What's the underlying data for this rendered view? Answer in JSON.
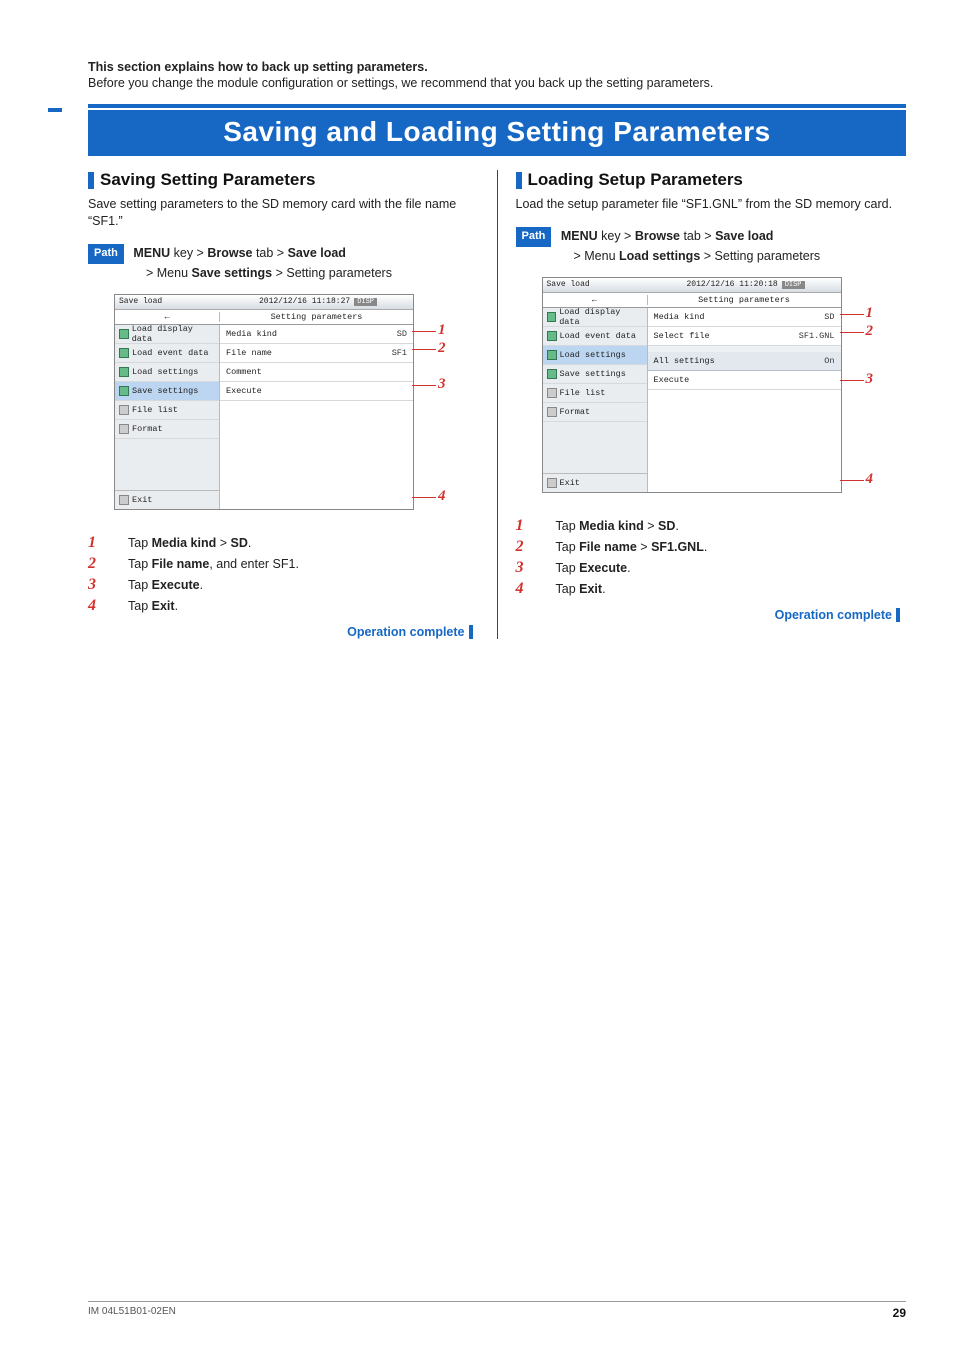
{
  "intro_bold": "This section explains how to back up setting parameters.",
  "intro_plain": "Before you change the module configuration or settings, we recommend that you back up the setting parameters.",
  "banner": "Saving and Loading Setting Parameters",
  "left": {
    "h2": "Saving Setting Parameters",
    "body": "Save setting parameters to the SD memory card with the file name “SF1.”",
    "path_label": "Path",
    "path_l1_a": "MENU",
    "path_l1_b": " key > ",
    "path_l1_c": "Browse",
    "path_l1_d": " tab > ",
    "path_l1_e": "Save load",
    "path_l2_a": "> Menu ",
    "path_l2_b": "Save settings",
    "path_l2_c": " > Setting parameters",
    "shot": {
      "title": "Save load",
      "ts": "2012/12/16 11:18:27",
      "badge": "DISP",
      "crumb": "Setting parameters",
      "back": "←",
      "nav": [
        "Load display data",
        "Load event data",
        "Load settings",
        "Save settings",
        "File list",
        "Format"
      ],
      "sel": 3,
      "rows": [
        {
          "lab": "Media kind",
          "val": "SD",
          "co": 1
        },
        {
          "lab": "File name",
          "val": "SF1",
          "co": 2
        },
        {
          "lab": "Comment",
          "val": ""
        },
        {
          "lab": "Execute",
          "val": "",
          "co": 3
        }
      ],
      "exit": "Exit",
      "exit_ic": "↪",
      "co_exit": 4
    },
    "steps": [
      {
        "n": "1",
        "pre": "Tap ",
        "b1": "Media kind",
        "mid": " > ",
        "b2": "SD",
        "post": "."
      },
      {
        "n": "2",
        "pre": "Tap ",
        "b1": "File name",
        "mid": ", and enter SF1.",
        "b2": "",
        "post": ""
      },
      {
        "n": "3",
        "pre": "Tap ",
        "b1": "Execute",
        "mid": ".",
        "b2": "",
        "post": ""
      },
      {
        "n": "4",
        "pre": "Tap ",
        "b1": "Exit",
        "mid": ".",
        "b2": "",
        "post": ""
      }
    ],
    "opc": "Operation complete"
  },
  "right": {
    "h2": "Loading Setup Parameters",
    "body": "Load the setup parameter file “SF1.GNL” from the SD memory card.",
    "path_label": "Path",
    "path_l1_a": "MENU",
    "path_l1_b": " key > ",
    "path_l1_c": "Browse",
    "path_l1_d": " tab > ",
    "path_l1_e": "Save load",
    "path_l2_a": "> Menu ",
    "path_l2_b": "Load settings",
    "path_l2_c": " > Setting parameters",
    "shot": {
      "title": "Save load",
      "ts": "2012/12/16 11:20:18",
      "badge": "DISP",
      "crumb": "Setting parameters",
      "back": "←",
      "nav": [
        "Load display data",
        "Load event data",
        "Load settings",
        "Save settings",
        "File list",
        "Format"
      ],
      "sel": 2,
      "rows": [
        {
          "lab": "Media kind",
          "val": "SD",
          "co": 1
        },
        {
          "lab": "Select file",
          "val": "SF1.GNL",
          "co": 2
        },
        {
          "lab": "All settings",
          "val": "On",
          "hdr": true
        },
        {
          "lab": "Execute",
          "val": "",
          "co": 3
        }
      ],
      "exit": "Exit",
      "exit_ic": "↪",
      "co_exit": 4
    },
    "steps": [
      {
        "n": "1",
        "pre": "Tap ",
        "b1": "Media kind",
        "mid": " > ",
        "b2": "SD",
        "post": "."
      },
      {
        "n": "2",
        "pre": "Tap ",
        "b1": "File name",
        "mid": " > ",
        "b2": "SF1.GNL",
        "post": "."
      },
      {
        "n": "3",
        "pre": "Tap ",
        "b1": "Execute",
        "mid": ".",
        "b2": "",
        "post": ""
      },
      {
        "n": "4",
        "pre": "Tap ",
        "b1": "Exit",
        "mid": ".",
        "b2": "",
        "post": ""
      }
    ],
    "opc": "Operation complete"
  },
  "footer": {
    "doc": "IM 04L51B01-02EN",
    "page": "29"
  }
}
